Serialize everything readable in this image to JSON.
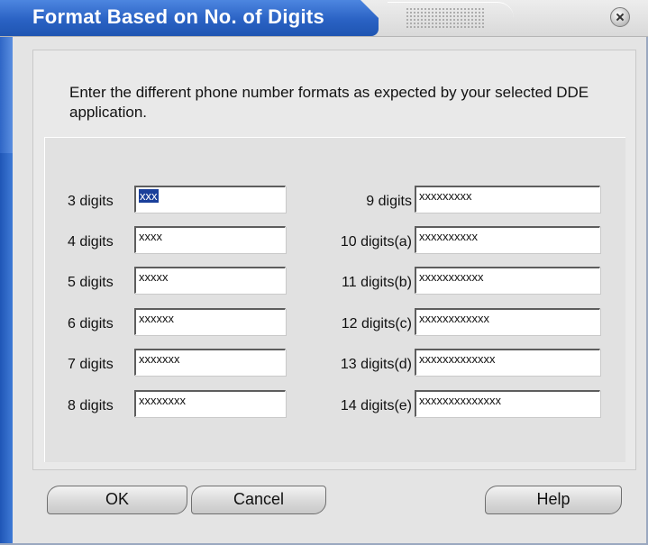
{
  "window": {
    "title": "Format Based on No. of Digits"
  },
  "description": "Enter the different phone number formats as expected by your selected DDE application.",
  "left_fields": [
    {
      "label": "3 digits",
      "value": "xxx"
    },
    {
      "label": "4 digits",
      "value": "xxxx"
    },
    {
      "label": "5 digits",
      "value": "xxxxx"
    },
    {
      "label": "6 digits",
      "value": "xxxxxx"
    },
    {
      "label": "7 digits",
      "value": "xxxxxxx"
    },
    {
      "label": "8 digits",
      "value": "xxxxxxxx"
    }
  ],
  "right_fields": [
    {
      "label": "9 digits",
      "value": "xxxxxxxxx"
    },
    {
      "label": "10 digits(a)",
      "value": "xxxxxxxxxx"
    },
    {
      "label": "11 digits(b)",
      "value": "xxxxxxxxxxx"
    },
    {
      "label": "12 digits(c)",
      "value": "xxxxxxxxxxxx"
    },
    {
      "label": "13 digits(d)",
      "value": "xxxxxxxxxxxxx"
    },
    {
      "label": "14 digits(e)",
      "value": "xxxxxxxxxxxxxx"
    }
  ],
  "buttons": {
    "ok": "OK",
    "cancel": "Cancel",
    "help": "Help"
  },
  "icons": {
    "close": "close-icon"
  }
}
